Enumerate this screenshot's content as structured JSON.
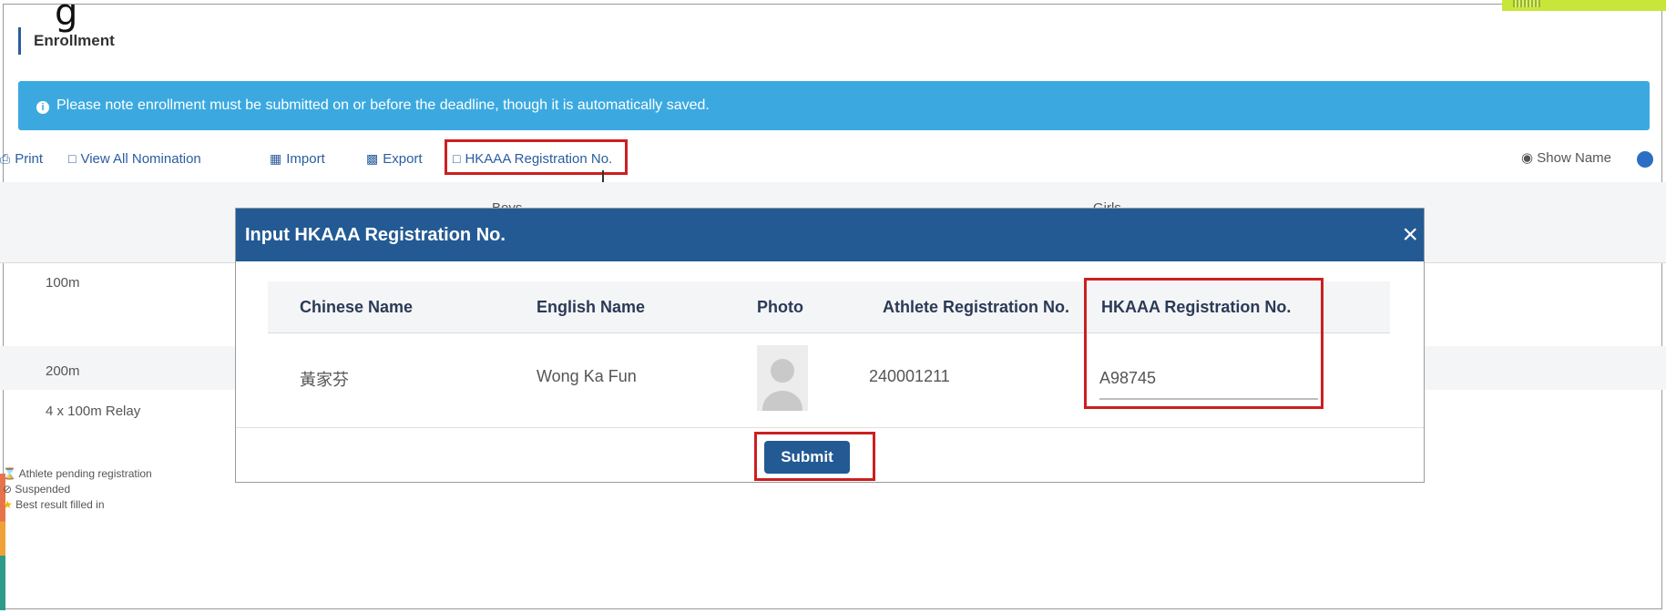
{
  "top_clip_text": "g",
  "page_title": "Enrollment",
  "alert": {
    "text": "Please note enrollment must be submitted on or before the deadline, though it is automatically saved.",
    "icon": "info-icon",
    "color": "#3ba9e0"
  },
  "toolbar": {
    "print": "Print",
    "view_all": "View All Nomination",
    "import": "Import",
    "export": "Export",
    "hkaaa": "HKAAA Registration No.",
    "show_name": "Show Name"
  },
  "background_table": {
    "headers": {
      "boys": "Boys",
      "girls": "Girls"
    },
    "rows": [
      "100m",
      "200m",
      "4 x 100m Relay"
    ]
  },
  "legend": {
    "pending": "Athlete pending registration",
    "suspended": "Suspended",
    "best": "Best result filled in"
  },
  "modal": {
    "title": "Input HKAAA Registration No.",
    "close": "×",
    "columns": [
      "Chinese Name",
      "English Name",
      "Photo",
      "Athlete Registration No.",
      "HKAAA Registration No."
    ],
    "row": {
      "chinese_name": "黃家芬",
      "english_name": "Wong Ka Fun",
      "athlete_reg_no": "240001211",
      "hkaaa_reg_no": "A98745"
    },
    "submit": "Submit"
  },
  "colors": {
    "primary": "#235a94",
    "highlight": "#cc1f1f",
    "accent_tab": "#c8e63a"
  }
}
